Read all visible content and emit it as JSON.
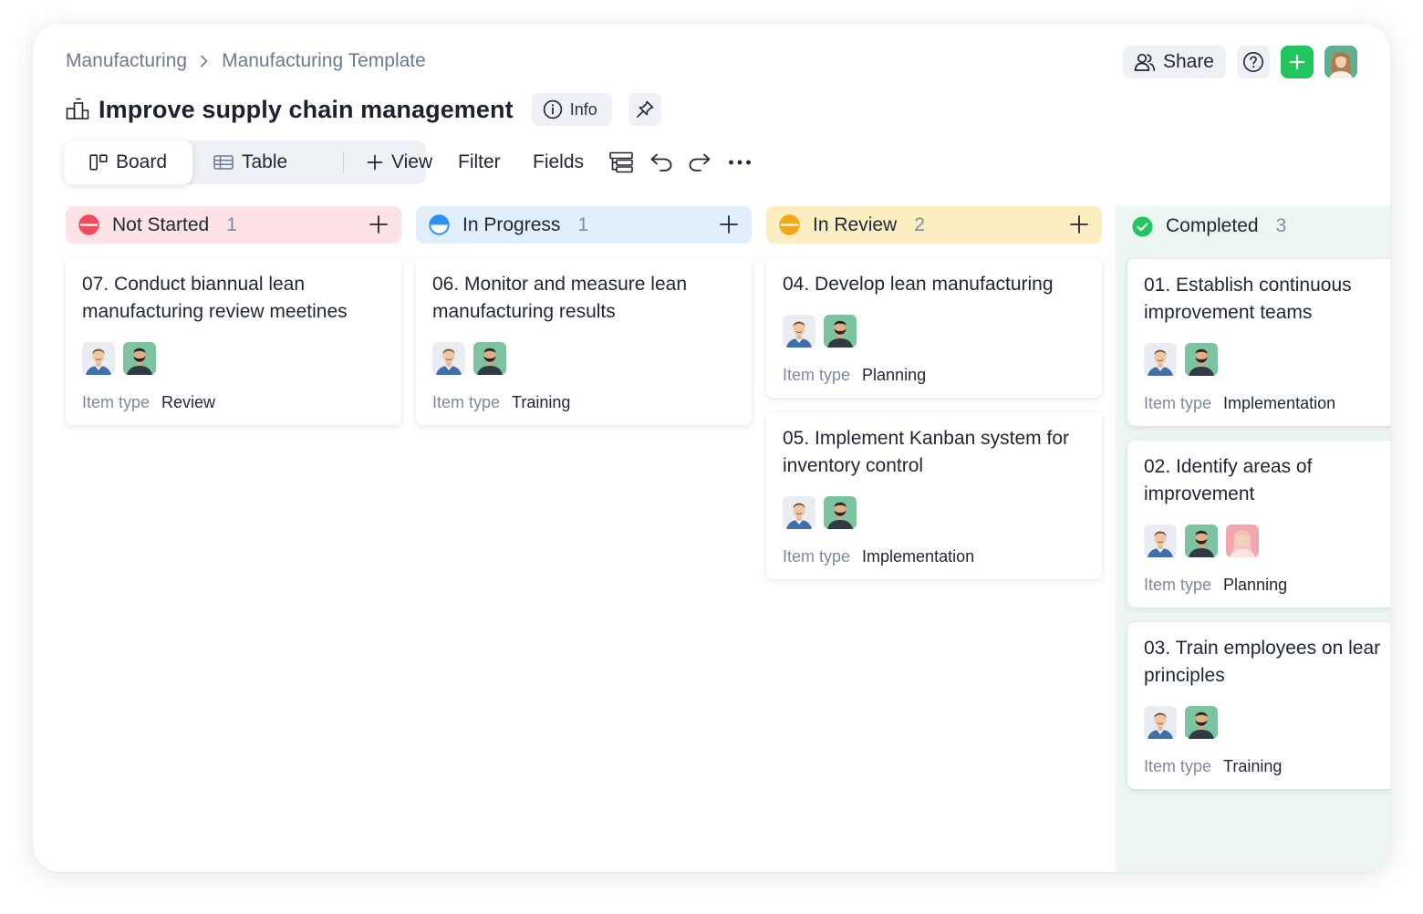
{
  "breadcrumb": {
    "root": "Manufacturing",
    "current": "Manufacturing Template"
  },
  "header": {
    "title": "Improve supply chain management",
    "info_label": "Info",
    "share_label": "Share"
  },
  "toolbar": {
    "tabs": [
      "Board",
      "Table",
      "View"
    ],
    "filter_label": "Filter",
    "fields_label": "Fields"
  },
  "colors": {
    "not_started": "#ef4b5c",
    "not_started_bg": "#fde3e6",
    "in_progress": "#2f8ff0",
    "in_progress_bg": "#e1eefb",
    "in_review": "#f4a716",
    "in_review_bg": "#fdeec2",
    "completed": "#22c55e",
    "completed_bg": "#edf6f2",
    "accent_green": "#22c55e"
  },
  "columns": [
    {
      "name": "Not Started",
      "count": "1",
      "cards": [
        {
          "title_lines": [
            "07. Conduct biannual lean",
            "manufacturing review meetines"
          ],
          "meta_label": "Item type",
          "meta_value": "Review",
          "avatars": [
            "man-avatar",
            "bearded-man-avatar"
          ]
        }
      ]
    },
    {
      "name": "In Progress",
      "count": "1",
      "cards": [
        {
          "title_lines": [
            "06. Monitor and measure lean",
            "manufacturing results"
          ],
          "meta_label": "Item type",
          "meta_value": "Training",
          "avatars": [
            "man-avatar",
            "bearded-man-avatar"
          ]
        }
      ]
    },
    {
      "name": "In Review",
      "count": "2",
      "cards": [
        {
          "title_lines": [
            "04. Develop lean manufacturing"
          ],
          "meta_label": "Item type",
          "meta_value": "Planning",
          "avatars": [
            "man-avatar",
            "bearded-man-avatar"
          ]
        },
        {
          "title_lines": [
            "05. Implement Kanban system for",
            "inventory control"
          ],
          "meta_label": "Item type",
          "meta_value": "Implementation",
          "avatars": [
            "man-avatar",
            "bearded-man-avatar"
          ]
        }
      ]
    },
    {
      "name": "Completed",
      "count": "3",
      "cards": [
        {
          "title_lines": [
            "01. Establish continuous",
            "improvement teams"
          ],
          "meta_label": "Item type",
          "meta_value": "Implementation",
          "avatars": [
            "man-avatar",
            "bearded-man-avatar"
          ]
        },
        {
          "title_lines": [
            "02. Identify areas of",
            "improvement"
          ],
          "meta_label": "Item type",
          "meta_value": "Planning",
          "avatars": [
            "man-avatar",
            "bearded-man-avatar",
            "woman-avatar"
          ]
        },
        {
          "title_lines": [
            "03. Train employees on lear",
            "principles"
          ],
          "meta_label": "Item type",
          "meta_value": "Training",
          "avatars": [
            "man-avatar",
            "bearded-man-avatar"
          ]
        }
      ]
    }
  ]
}
